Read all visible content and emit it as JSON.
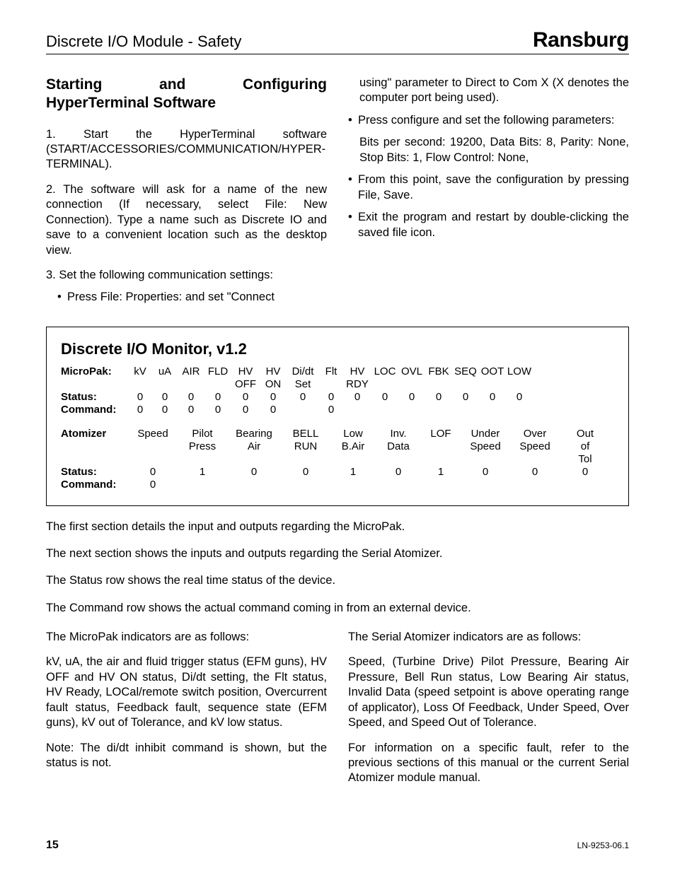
{
  "header": {
    "title": "Discrete I/O Module - Safety",
    "brand": "Ransburg"
  },
  "left_col": {
    "heading": "Starting and Configuring HyperTerminal Software",
    "p1": "1.  Start the HyperTerminal software (START/ACCESSORIES/COMMUNICATION/HYPER-TERMINAL).",
    "p2": "2.  The software will ask for a name of the new connection (If necessary, select File: New Connection).  Type a name such as Discrete IO and save to a convenient location such as the desktop view.",
    "p3": "3.  Set the following communication settings:",
    "b1": "Press File: Properties: and set \"Connect"
  },
  "right_col": {
    "cont": "using\" parameter to Direct to Com X (X denotes the computer port being used).",
    "b2": "Press configure and set the following parameters:",
    "params": "Bits per second: 19200,  Data Bits: 8,  Parity: None, Stop Bits: 1, Flow Control: None,",
    "b3": "From this point, save the configuration by pressing File, Save.",
    "b4": "Exit  the program and restart by double-clicking the saved file icon."
  },
  "monitor": {
    "title": "Discrete I/O Monitor, v1.2",
    "micropak": {
      "label": "MicroPak:",
      "status_label": "Status:",
      "command_label": "Command:",
      "headers": [
        "kV",
        "uA",
        "AIR",
        "FLD",
        "HV OFF",
        "HV ON",
        "Di/dt Set",
        "Flt",
        "HV RDY",
        "LOC",
        "OVL",
        "FBK",
        "SEQ",
        "OOT",
        "LOW"
      ],
      "status": [
        "0",
        "0",
        "0",
        "0",
        "0",
        "0",
        "0",
        "0",
        "0",
        "0",
        "0",
        "0",
        "0",
        "0",
        "0"
      ],
      "command": [
        "0",
        "0",
        "0",
        "0",
        "0",
        "0",
        "",
        "0",
        "",
        "",
        "",
        "",
        "",
        "",
        ""
      ]
    },
    "atomizer": {
      "label": "Atomizer",
      "status_label": "Status:",
      "command_label": "Command:",
      "headers": [
        "Speed",
        "Pilot Press",
        "Bearing Air",
        "BELL RUN",
        "Low B.Air",
        "Inv. Data",
        "LOF",
        "Under Speed",
        "Over Speed",
        "Out of Tol"
      ],
      "status": [
        "0",
        "1",
        "0",
        "0",
        "1",
        "0",
        "1",
        "0",
        "0",
        "0"
      ],
      "command": [
        "0",
        "",
        "",
        "",
        "",
        "",
        "",
        "",
        "",
        ""
      ]
    }
  },
  "below": {
    "p1": "The first section details the input and outputs regarding the MicroPak.",
    "p2": "The next section shows the inputs and outputs regarding the Serial Atomizer.",
    "p3": "The Status row shows the real time status of the device.",
    "p4": "The Command row shows the actual command coming in from an external device."
  },
  "bottom_left": {
    "p1": "The MicroPak indicators are as follows:",
    "p2": "kV, uA, the air and fluid trigger status (EFM guns), HV OFF and HV ON status, Di/dt setting, the Flt status, HV Ready, LOCal/remote switch position, Overcurrent fault status, Feedback fault, sequence state (EFM guns), kV out of Tolerance, and kV low status.",
    "p3": "Note:  The di/dt inhibit command is shown, but the status is not."
  },
  "bottom_right": {
    "p1": "The Serial Atomizer indicators are as follows:",
    "p2": "Speed, (Turbine Drive) Pilot Pressure, Bearing Air Pressure, Bell Run status, Low Bearing Air status, Invalid Data (speed setpoint is above operating range of applicator), Loss Of Feedback, Under Speed, Over Speed, and Speed Out of Tolerance.",
    "p3": "For information on a specific fault, refer to the previous sections of this manual or the current Serial Atomizer module manual."
  },
  "footer": {
    "page": "15",
    "docid": "LN-9253-06.1"
  }
}
